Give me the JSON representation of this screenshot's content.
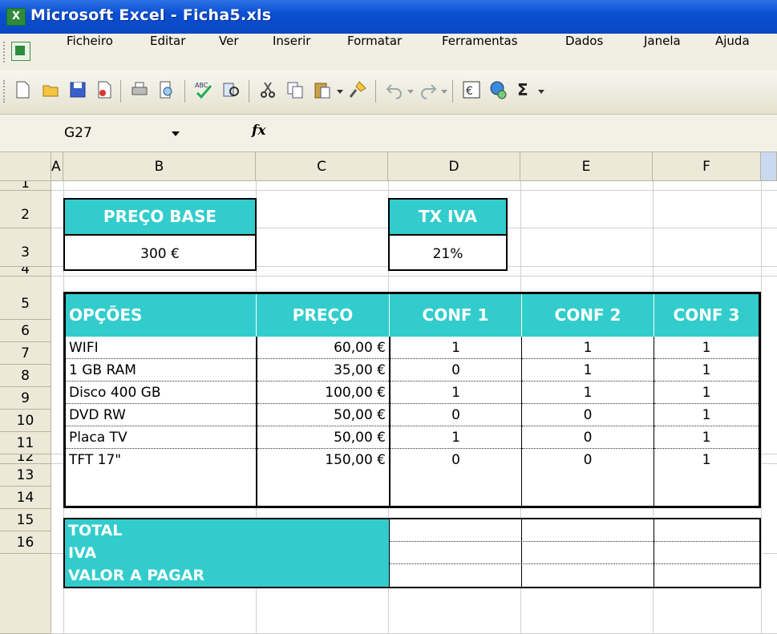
{
  "window": {
    "title": "Microsoft Excel - Ficha5.xls",
    "app_icon": "excel-icon"
  },
  "menu": [
    "Ficheiro",
    "Editar",
    "Ver",
    "Inserir",
    "Formatar",
    "Ferramentas",
    "Dados",
    "Janela",
    "Ajuda"
  ],
  "toolbar": {
    "sigma": "Σ"
  },
  "formula_bar": {
    "name_box": "G27",
    "fx_label": "fx",
    "formula": ""
  },
  "columns": [
    "A",
    "B",
    "C",
    "D",
    "E",
    "F"
  ],
  "rows": [
    "1",
    "2",
    "3",
    "4",
    "5",
    "6",
    "7",
    "8",
    "9",
    "10",
    "11",
    "12",
    "13",
    "14",
    "15",
    "16"
  ],
  "sheet": {
    "preco_base_label": "PREÇO BASE",
    "preco_base_value": "300 €",
    "tx_iva_label": "TX IVA",
    "tx_iva_value": "21%",
    "headers": [
      "OPÇÕES",
      "PREÇO",
      "CONF 1",
      "CONF 2",
      "CONF 3"
    ],
    "options": [
      {
        "name": "WIFI",
        "price": "60,00 €",
        "c1": "1",
        "c2": "1",
        "c3": "1"
      },
      {
        "name": "1 GB RAM",
        "price": "35,00 €",
        "c1": "0",
        "c2": "1",
        "c3": "1"
      },
      {
        "name": "Disco 400 GB",
        "price": "100,00 €",
        "c1": "1",
        "c2": "1",
        "c3": "1"
      },
      {
        "name": "DVD RW",
        "price": "50,00 €",
        "c1": "0",
        "c2": "0",
        "c3": "1"
      },
      {
        "name": "Placa TV",
        "price": "50,00 €",
        "c1": "1",
        "c2": "0",
        "c3": "1"
      },
      {
        "name": "TFT 17\"",
        "price": "150,00 €",
        "c1": "0",
        "c2": "0",
        "c3": "1"
      }
    ],
    "summary": [
      "TOTAL",
      "IVA",
      "VALOR A PAGAR"
    ]
  },
  "colors": {
    "teal": "#33cccc",
    "titlebar": "#0a4fd1"
  }
}
